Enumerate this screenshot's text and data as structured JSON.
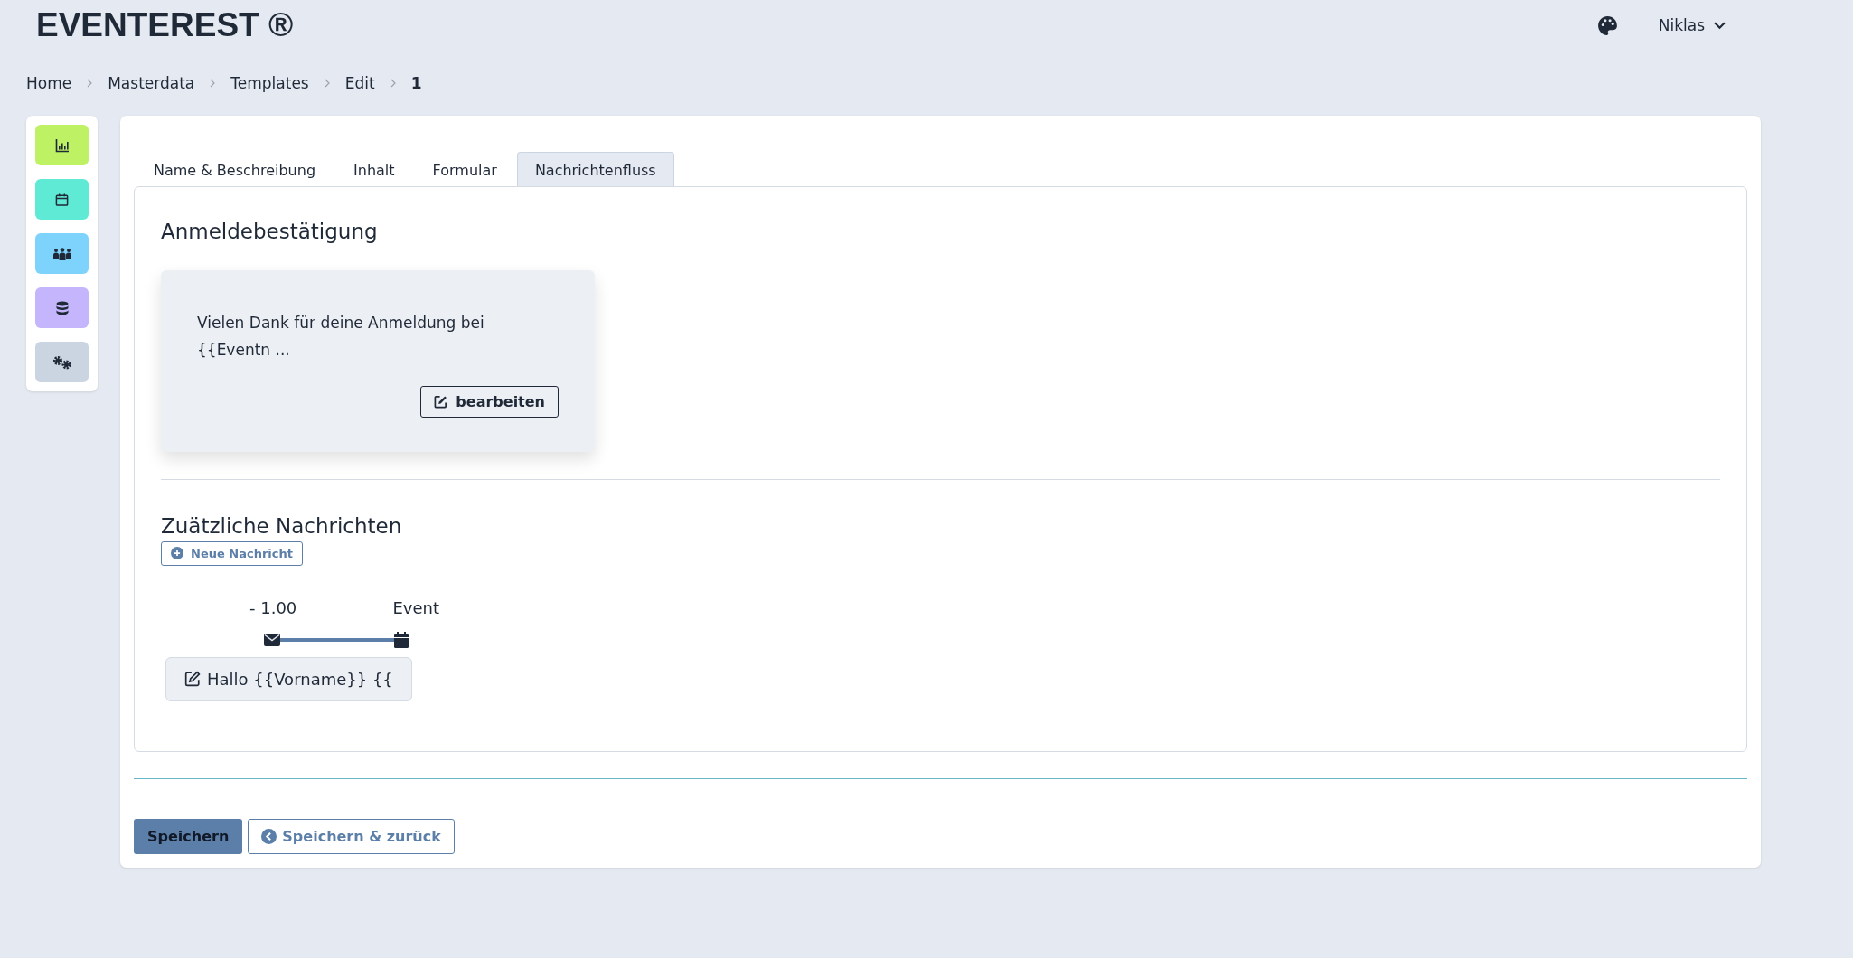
{
  "header": {
    "logo": "EVENTEREST ®",
    "user": "Niklas"
  },
  "breadcrumb": [
    {
      "label": "Home",
      "current": false
    },
    {
      "label": "Masterdata",
      "current": false
    },
    {
      "label": "Templates",
      "current": false
    },
    {
      "label": "Edit",
      "current": false
    },
    {
      "label": "1",
      "current": true
    }
  ],
  "sidebar": {
    "items": [
      {
        "kind": "chart",
        "color": "#bef264"
      },
      {
        "kind": "calendar",
        "color": "#5eead4"
      },
      {
        "kind": "people",
        "color": "#7dd3fc"
      },
      {
        "kind": "database",
        "color": "#c4b5fd"
      },
      {
        "kind": "gears",
        "color": "#cbd5e1"
      }
    ]
  },
  "tabs": [
    {
      "label": "Name & Beschreibung",
      "selected": false
    },
    {
      "label": "Inhalt",
      "selected": false
    },
    {
      "label": "Formular",
      "selected": false
    },
    {
      "label": "Nachrichtenfluss",
      "selected": true
    }
  ],
  "confirmation": {
    "heading": "Anmeldebestätigung",
    "preview": "Vielen Dank für deine Anmeldung bei {{Eventn ...",
    "edit_button": "bearbeiten"
  },
  "additional": {
    "heading": "Zuätzliche Nachrichten",
    "new_button": "Neue Nachricht",
    "timeline": {
      "offset": "- 1.00",
      "anchor": "Event"
    },
    "messages": [
      {
        "label": "Hallo {{Vorname}} {{"
      }
    ]
  },
  "actions": {
    "save": "Speichern",
    "save_back": "Speichern & zurück"
  }
}
